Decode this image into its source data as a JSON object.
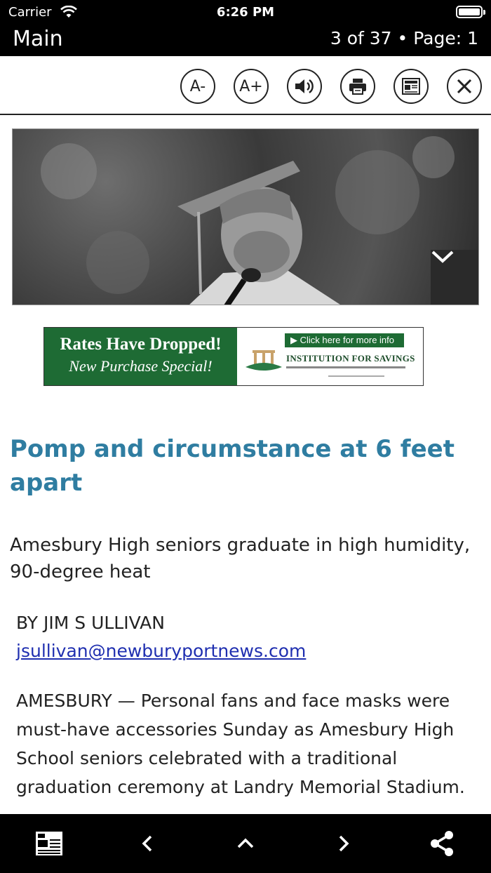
{
  "status_bar": {
    "carrier": "Carrier",
    "time": "6:26 PM"
  },
  "nav": {
    "title": "Main",
    "page_info": "3 of 37 • Page: 1"
  },
  "toolbar": {
    "decrease_font": "A-",
    "increase_font": "A+",
    "icons": [
      "volume-icon",
      "print-icon",
      "newspaper-icon",
      "close-icon"
    ]
  },
  "ad": {
    "headline": "Rates Have Dropped!",
    "subline": "New Purchase Special!",
    "cta": "▶ Click here for more info",
    "bank_name": "INSTITUTION FOR SAVINGS"
  },
  "article": {
    "headline": "Pomp and circumstance at 6 feet apart",
    "subheadline": "Amesbury High seniors graduate in high humidity, 90-degree heat",
    "byline": "BY JIM S ULLIVAN",
    "email": "jsullivan@newburyportnews.com",
    "body": "AMESBURY — Personal fans and face masks were must-have accessories Sunday as Amesbury High School seniors celebrated with a traditional graduation ceremony at Landry Memorial Stadium."
  },
  "colors": {
    "headline": "#2f7da1",
    "link": "#1f2fb0",
    "ad_green": "#1e6b34"
  }
}
